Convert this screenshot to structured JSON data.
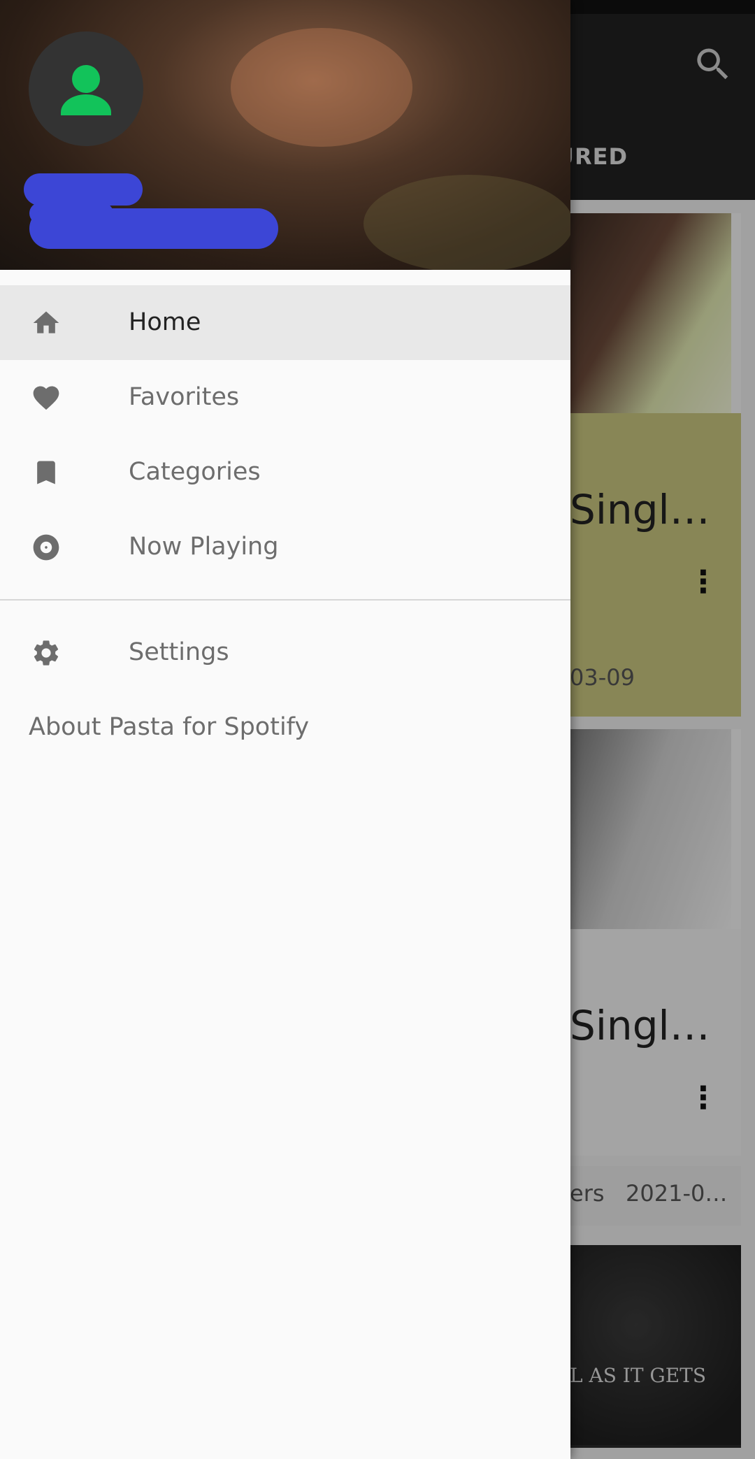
{
  "background": {
    "tab_fragment": "URED",
    "cards": [
      {
        "title_fragment": "Singl…",
        "meta": "03-09",
        "side_text": ""
      },
      {
        "title_fragment": "Singl…",
        "meta": "",
        "side_text": ""
      },
      {
        "title_fragment": "",
        "meta": "ers   2021-0…",
        "art_text": "L AS IT GETS"
      }
    ],
    "more_icon": "⋮"
  },
  "drawer": {
    "menu": [
      {
        "label": "Home",
        "icon": "home-icon",
        "active": true
      },
      {
        "label": "Favorites",
        "icon": "heart-icon",
        "active": false
      },
      {
        "label": "Categories",
        "icon": "bookmark-icon",
        "active": false
      },
      {
        "label": "Now Playing",
        "icon": "disc-icon",
        "active": false
      }
    ],
    "settings_label": "Settings",
    "about_label": "About Pasta for Spotify"
  },
  "colors": {
    "accent_green": "#12c35a",
    "redaction_blue": "#3c46d6",
    "active_row": "#e8e8e8"
  }
}
